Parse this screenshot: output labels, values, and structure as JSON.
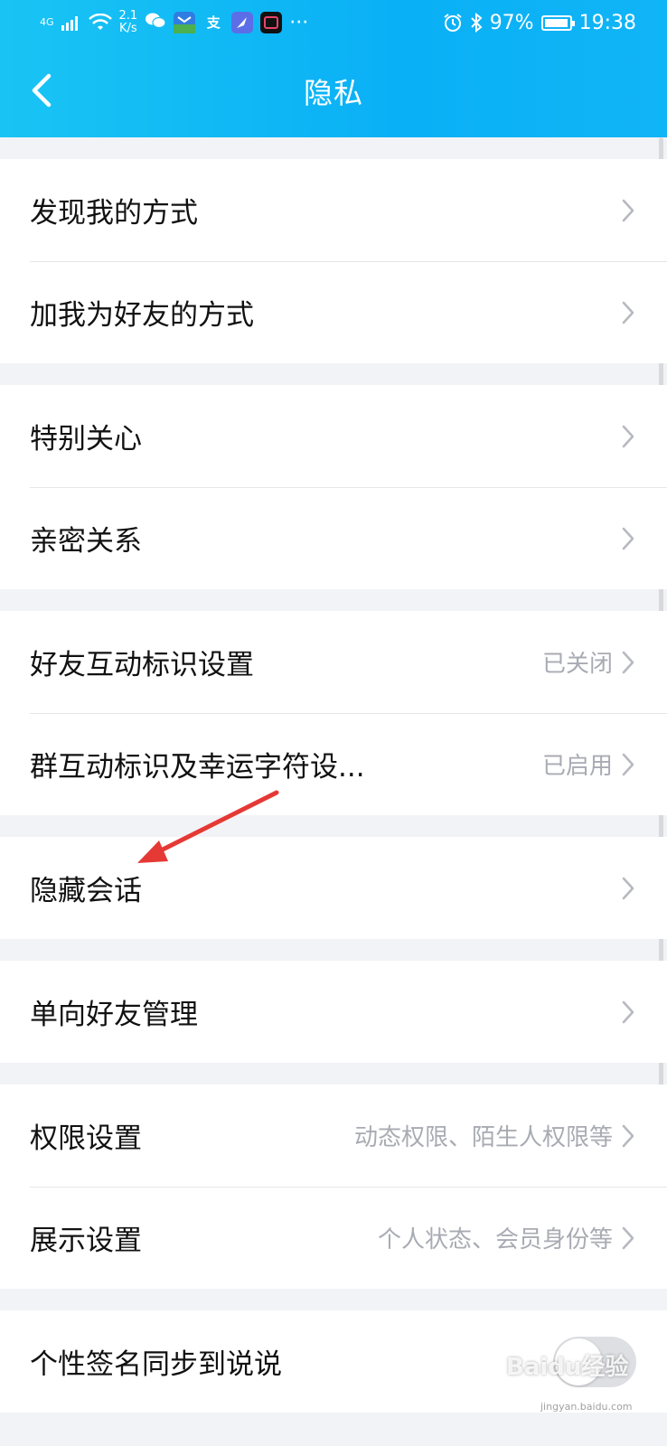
{
  "status_bar": {
    "network": "4G",
    "speed_value": "2.1",
    "speed_unit": "K/s",
    "more": "···",
    "battery": "97%",
    "battery_level": 0.97,
    "time": "19:38"
  },
  "header": {
    "title": "隐私"
  },
  "groups": [
    {
      "items": [
        {
          "label": "发现我的方式",
          "value": ""
        },
        {
          "label": "加我为好友的方式",
          "value": ""
        }
      ]
    },
    {
      "items": [
        {
          "label": "特别关心",
          "value": ""
        },
        {
          "label": "亲密关系",
          "value": ""
        }
      ]
    },
    {
      "items": [
        {
          "label": "好友互动标识设置",
          "value": "已关闭"
        },
        {
          "label": "群互动标识及幸运字符设...",
          "value": "已启用"
        }
      ]
    },
    {
      "items": [
        {
          "label": "隐藏会话",
          "value": ""
        }
      ]
    },
    {
      "items": [
        {
          "label": "单向好友管理",
          "value": ""
        }
      ]
    },
    {
      "items": [
        {
          "label": "权限设置",
          "value": "动态权限、陌生人权限等"
        },
        {
          "label": "展示设置",
          "value": "个人状态、会员身份等"
        }
      ]
    },
    {
      "items": [
        {
          "label": "个性签名同步到说说",
          "toggle": false
        }
      ]
    }
  ],
  "annotation_color": "#e53935",
  "watermark": {
    "brand": "Baidu经验",
    "url": "jingyan.baidu.com"
  }
}
